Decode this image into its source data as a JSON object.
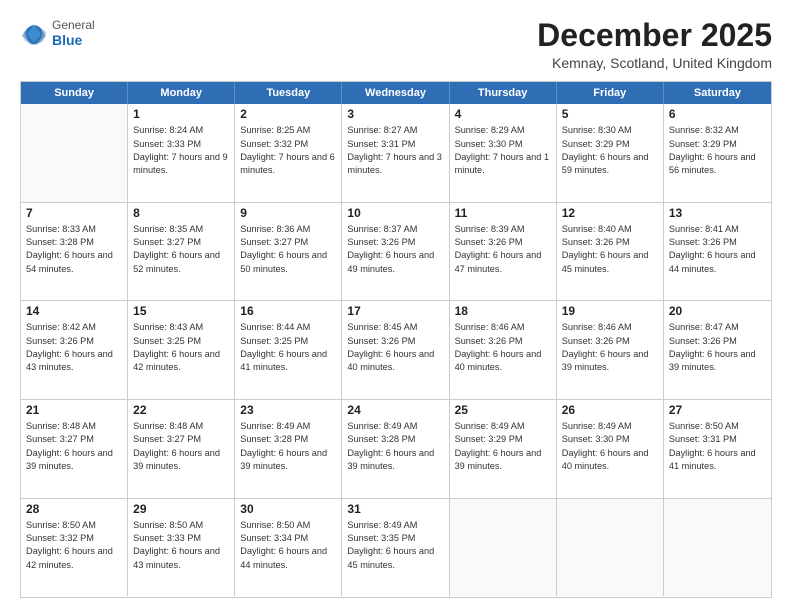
{
  "header": {
    "logo_general": "General",
    "logo_blue": "Blue",
    "month_title": "December 2025",
    "location": "Kemnay, Scotland, United Kingdom"
  },
  "weekdays": [
    "Sunday",
    "Monday",
    "Tuesday",
    "Wednesday",
    "Thursday",
    "Friday",
    "Saturday"
  ],
  "rows": [
    [
      {
        "day": "",
        "sunrise": "",
        "sunset": "",
        "daylight": ""
      },
      {
        "day": "1",
        "sunrise": "Sunrise: 8:24 AM",
        "sunset": "Sunset: 3:33 PM",
        "daylight": "Daylight: 7 hours and 9 minutes."
      },
      {
        "day": "2",
        "sunrise": "Sunrise: 8:25 AM",
        "sunset": "Sunset: 3:32 PM",
        "daylight": "Daylight: 7 hours and 6 minutes."
      },
      {
        "day": "3",
        "sunrise": "Sunrise: 8:27 AM",
        "sunset": "Sunset: 3:31 PM",
        "daylight": "Daylight: 7 hours and 3 minutes."
      },
      {
        "day": "4",
        "sunrise": "Sunrise: 8:29 AM",
        "sunset": "Sunset: 3:30 PM",
        "daylight": "Daylight: 7 hours and 1 minute."
      },
      {
        "day": "5",
        "sunrise": "Sunrise: 8:30 AM",
        "sunset": "Sunset: 3:29 PM",
        "daylight": "Daylight: 6 hours and 59 minutes."
      },
      {
        "day": "6",
        "sunrise": "Sunrise: 8:32 AM",
        "sunset": "Sunset: 3:29 PM",
        "daylight": "Daylight: 6 hours and 56 minutes."
      }
    ],
    [
      {
        "day": "7",
        "sunrise": "Sunrise: 8:33 AM",
        "sunset": "Sunset: 3:28 PM",
        "daylight": "Daylight: 6 hours and 54 minutes."
      },
      {
        "day": "8",
        "sunrise": "Sunrise: 8:35 AM",
        "sunset": "Sunset: 3:27 PM",
        "daylight": "Daylight: 6 hours and 52 minutes."
      },
      {
        "day": "9",
        "sunrise": "Sunrise: 8:36 AM",
        "sunset": "Sunset: 3:27 PM",
        "daylight": "Daylight: 6 hours and 50 minutes."
      },
      {
        "day": "10",
        "sunrise": "Sunrise: 8:37 AM",
        "sunset": "Sunset: 3:26 PM",
        "daylight": "Daylight: 6 hours and 49 minutes."
      },
      {
        "day": "11",
        "sunrise": "Sunrise: 8:39 AM",
        "sunset": "Sunset: 3:26 PM",
        "daylight": "Daylight: 6 hours and 47 minutes."
      },
      {
        "day": "12",
        "sunrise": "Sunrise: 8:40 AM",
        "sunset": "Sunset: 3:26 PM",
        "daylight": "Daylight: 6 hours and 45 minutes."
      },
      {
        "day": "13",
        "sunrise": "Sunrise: 8:41 AM",
        "sunset": "Sunset: 3:26 PM",
        "daylight": "Daylight: 6 hours and 44 minutes."
      }
    ],
    [
      {
        "day": "14",
        "sunrise": "Sunrise: 8:42 AM",
        "sunset": "Sunset: 3:26 PM",
        "daylight": "Daylight: 6 hours and 43 minutes."
      },
      {
        "day": "15",
        "sunrise": "Sunrise: 8:43 AM",
        "sunset": "Sunset: 3:25 PM",
        "daylight": "Daylight: 6 hours and 42 minutes."
      },
      {
        "day": "16",
        "sunrise": "Sunrise: 8:44 AM",
        "sunset": "Sunset: 3:25 PM",
        "daylight": "Daylight: 6 hours and 41 minutes."
      },
      {
        "day": "17",
        "sunrise": "Sunrise: 8:45 AM",
        "sunset": "Sunset: 3:26 PM",
        "daylight": "Daylight: 6 hours and 40 minutes."
      },
      {
        "day": "18",
        "sunrise": "Sunrise: 8:46 AM",
        "sunset": "Sunset: 3:26 PM",
        "daylight": "Daylight: 6 hours and 40 minutes."
      },
      {
        "day": "19",
        "sunrise": "Sunrise: 8:46 AM",
        "sunset": "Sunset: 3:26 PM",
        "daylight": "Daylight: 6 hours and 39 minutes."
      },
      {
        "day": "20",
        "sunrise": "Sunrise: 8:47 AM",
        "sunset": "Sunset: 3:26 PM",
        "daylight": "Daylight: 6 hours and 39 minutes."
      }
    ],
    [
      {
        "day": "21",
        "sunrise": "Sunrise: 8:48 AM",
        "sunset": "Sunset: 3:27 PM",
        "daylight": "Daylight: 6 hours and 39 minutes."
      },
      {
        "day": "22",
        "sunrise": "Sunrise: 8:48 AM",
        "sunset": "Sunset: 3:27 PM",
        "daylight": "Daylight: 6 hours and 39 minutes."
      },
      {
        "day": "23",
        "sunrise": "Sunrise: 8:49 AM",
        "sunset": "Sunset: 3:28 PM",
        "daylight": "Daylight: 6 hours and 39 minutes."
      },
      {
        "day": "24",
        "sunrise": "Sunrise: 8:49 AM",
        "sunset": "Sunset: 3:28 PM",
        "daylight": "Daylight: 6 hours and 39 minutes."
      },
      {
        "day": "25",
        "sunrise": "Sunrise: 8:49 AM",
        "sunset": "Sunset: 3:29 PM",
        "daylight": "Daylight: 6 hours and 39 minutes."
      },
      {
        "day": "26",
        "sunrise": "Sunrise: 8:49 AM",
        "sunset": "Sunset: 3:30 PM",
        "daylight": "Daylight: 6 hours and 40 minutes."
      },
      {
        "day": "27",
        "sunrise": "Sunrise: 8:50 AM",
        "sunset": "Sunset: 3:31 PM",
        "daylight": "Daylight: 6 hours and 41 minutes."
      }
    ],
    [
      {
        "day": "28",
        "sunrise": "Sunrise: 8:50 AM",
        "sunset": "Sunset: 3:32 PM",
        "daylight": "Daylight: 6 hours and 42 minutes."
      },
      {
        "day": "29",
        "sunrise": "Sunrise: 8:50 AM",
        "sunset": "Sunset: 3:33 PM",
        "daylight": "Daylight: 6 hours and 43 minutes."
      },
      {
        "day": "30",
        "sunrise": "Sunrise: 8:50 AM",
        "sunset": "Sunset: 3:34 PM",
        "daylight": "Daylight: 6 hours and 44 minutes."
      },
      {
        "day": "31",
        "sunrise": "Sunrise: 8:49 AM",
        "sunset": "Sunset: 3:35 PM",
        "daylight": "Daylight: 6 hours and 45 minutes."
      },
      {
        "day": "",
        "sunrise": "",
        "sunset": "",
        "daylight": ""
      },
      {
        "day": "",
        "sunrise": "",
        "sunset": "",
        "daylight": ""
      },
      {
        "day": "",
        "sunrise": "",
        "sunset": "",
        "daylight": ""
      }
    ]
  ]
}
